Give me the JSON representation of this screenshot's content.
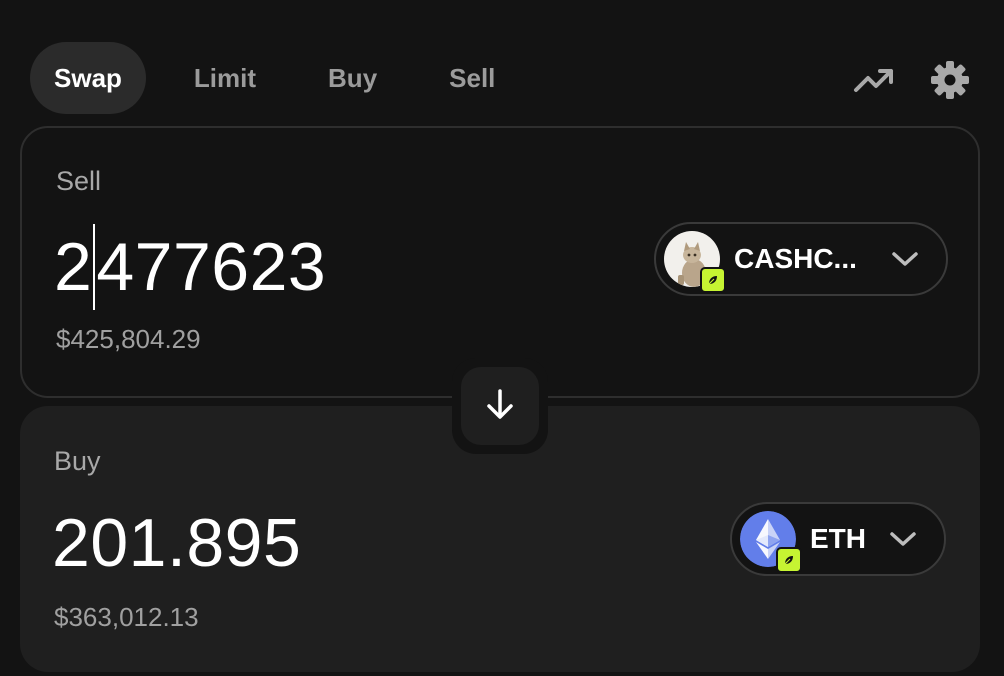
{
  "tabs": [
    {
      "label": "Swap",
      "active": true
    },
    {
      "label": "Limit",
      "active": false
    },
    {
      "label": "Buy",
      "active": false
    },
    {
      "label": "Sell",
      "active": false
    }
  ],
  "icons": {
    "trending": "trending-up-icon",
    "settings": "gear-icon",
    "switch": "arrow-down-icon",
    "chevron": "chevron-down-icon",
    "chain_badge": "leaf-icon"
  },
  "sell": {
    "label": "Sell",
    "amount_first": "2",
    "amount_rest": "477623",
    "usd_value": "$425,804.29",
    "token_symbol": "CASHC..."
  },
  "buy": {
    "label": "Buy",
    "amount": "201.895",
    "usd_value": "$363,012.13",
    "token_symbol": "ETH"
  },
  "colors": {
    "background": "#131313",
    "panel": "#1f1f1f",
    "active_tab": "#2b2b2b",
    "badge": "#c6f432",
    "eth_logo": "#627eea"
  }
}
